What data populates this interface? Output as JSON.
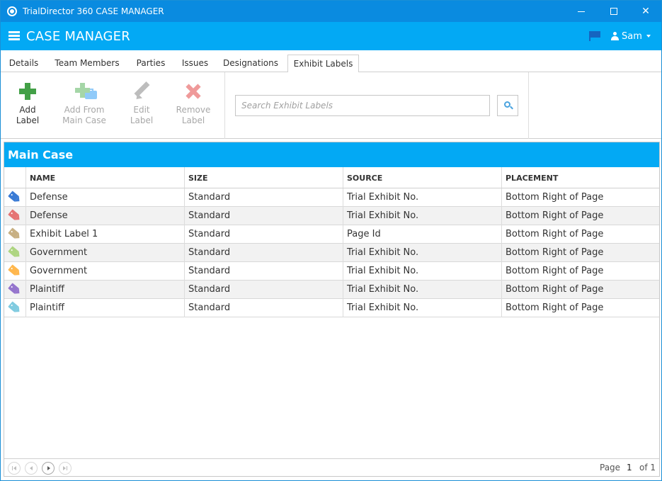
{
  "window": {
    "title": "TrialDirector 360 CASE MANAGER"
  },
  "header": {
    "title": "CASE MANAGER",
    "user": "Sam"
  },
  "tabs": [
    {
      "label": "Details"
    },
    {
      "label": "Team Members"
    },
    {
      "label": "Parties"
    },
    {
      "label": "Issues"
    },
    {
      "label": "Designations"
    },
    {
      "label": "Exhibit Labels",
      "active": true
    }
  ],
  "toolbar": {
    "add": "Add\nLabel",
    "add_from_main": "Add From\nMain Case",
    "edit": "Edit\nLabel",
    "remove": "Remove\nLabel",
    "search_placeholder": "Search Exhibit Labels"
  },
  "grid": {
    "title": "Main Case",
    "columns": [
      "NAME",
      "SIZE",
      "SOURCE",
      "PLACEMENT"
    ],
    "rows": [
      {
        "color": "#3a7bd5",
        "name": "Defense",
        "size": "Standard",
        "source": "Trial Exhibit No.",
        "placement": "Bottom Right of Page"
      },
      {
        "color": "#e57373",
        "name": "Defense",
        "size": "Standard",
        "source": "Trial Exhibit No.",
        "placement": "Bottom Right of Page"
      },
      {
        "color": "#c8b083",
        "name": "Exhibit Label 1",
        "size": "Standard",
        "source": "Page Id",
        "placement": "Bottom Right of Page"
      },
      {
        "color": "#aed581",
        "name": "Government",
        "size": "Standard",
        "source": "Trial Exhibit No.",
        "placement": "Bottom Right of Page"
      },
      {
        "color": "#ffb74d",
        "name": "Government",
        "size": "Standard",
        "source": "Trial Exhibit No.",
        "placement": "Bottom Right of Page"
      },
      {
        "color": "#9575cd",
        "name": "Plaintiff",
        "size": "Standard",
        "source": "Trial Exhibit No.",
        "placement": "Bottom Right of Page"
      },
      {
        "color": "#80cbe0",
        "name": "Plaintiff",
        "size": "Standard",
        "source": "Trial Exhibit No.",
        "placement": "Bottom Right of Page"
      }
    ]
  },
  "pager": {
    "page_label": "Page",
    "current_page": "1",
    "of_label": "of 1"
  },
  "colors": {
    "accent": "#03a9f4",
    "titlebar": "#0a8be0",
    "add_green": "#43a047"
  },
  "icons": [
    "app-icon",
    "hamburger-icon",
    "flag-icon",
    "user-icon",
    "plus-icon",
    "plus-case-icon",
    "pencil-icon",
    "x-icon",
    "search-icon",
    "tag-icon"
  ]
}
